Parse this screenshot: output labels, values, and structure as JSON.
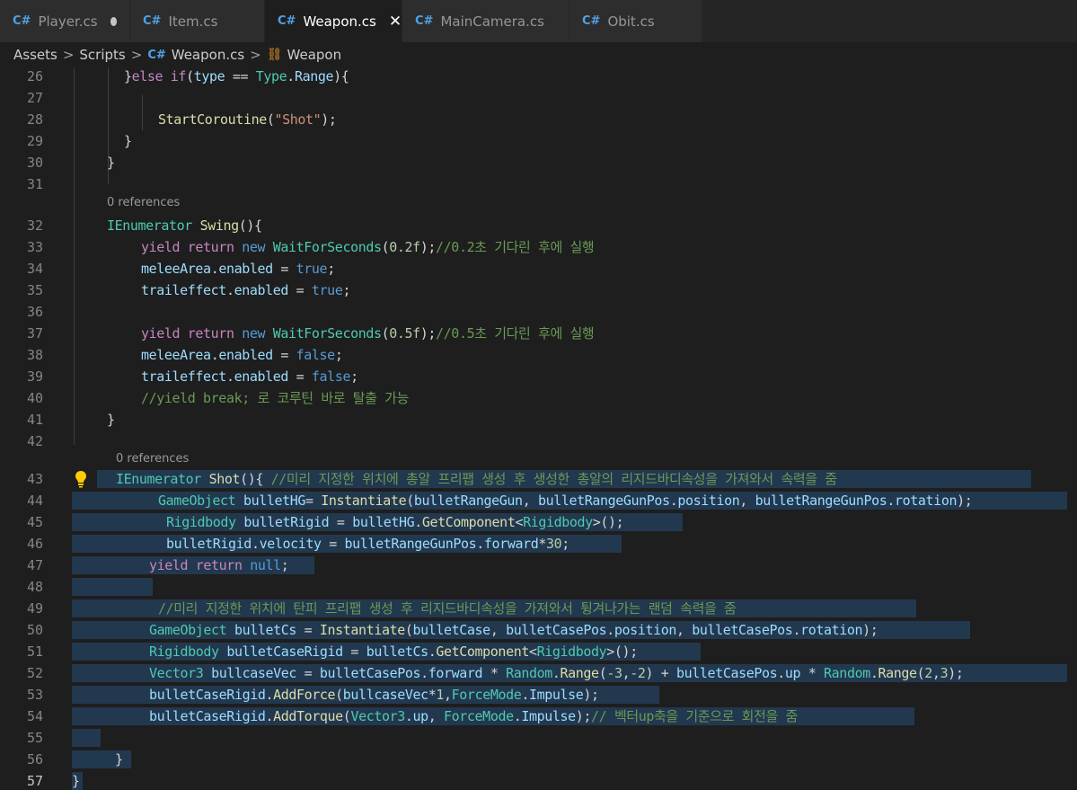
{
  "tabs": [
    {
      "label": "Player.cs",
      "modified": true,
      "active": false
    },
    {
      "label": "Item.cs",
      "modified": false,
      "active": false
    },
    {
      "label": "Weapon.cs",
      "modified": false,
      "active": true
    },
    {
      "label": "MainCamera.cs",
      "modified": false,
      "active": false
    },
    {
      "label": "Obit.cs",
      "modified": false,
      "active": false
    }
  ],
  "breadcrumb": {
    "assets": "Assets",
    "scripts": "Scripts",
    "file": "Weapon.cs",
    "class": "Weapon"
  },
  "editor": {
    "line_numbers": [
      "26",
      "27",
      "28",
      "29",
      "30",
      "31",
      "32",
      "33",
      "34",
      "35",
      "36",
      "37",
      "38",
      "39",
      "40",
      "41",
      "42",
      "43",
      "44",
      "45",
      "46",
      "47",
      "48",
      "49",
      "50",
      "51",
      "52",
      "53",
      "54",
      "55",
      "56",
      "57"
    ],
    "codelens_swing": "0 references",
    "codelens_shot": "0 references",
    "lines": {
      "l26": [
        "}",
        "else if",
        "(",
        "type",
        " == ",
        "Type",
        ".",
        "Range",
        "){"
      ],
      "l28": [
        "StartCoroutine",
        "(",
        "\"Shot\"",
        ");"
      ],
      "l29": "}",
      "l30": "}",
      "l32": [
        "IEnumerator",
        " ",
        "Swing",
        "(){"
      ],
      "l33": [
        "yield return",
        " ",
        "new",
        " ",
        "WaitForSeconds",
        "(",
        "0.2f",
        ");",
        "//0.2초 기다린 후에 실행"
      ],
      "l34": [
        "meleeArea",
        ".",
        "enabled",
        " = ",
        "true",
        ";"
      ],
      "l35": [
        "traileffect",
        ".",
        "enabled",
        " = ",
        "true",
        ";"
      ],
      "l37": [
        "yield return",
        " ",
        "new",
        " ",
        "WaitForSeconds",
        "(",
        "0.5f",
        ");",
        "//0.5초 기다린 후에 실행"
      ],
      "l38": [
        "meleeArea",
        ".",
        "enabled",
        " = ",
        "false",
        ";"
      ],
      "l39": [
        "traileffect",
        ".",
        "enabled",
        " = ",
        "false",
        ";"
      ],
      "l40": "//yield break; 로 코루틴 바로 탈출 가능",
      "l41": "}",
      "l43": [
        "IEnumerator",
        " ",
        "Shot",
        "(){ ",
        "//미리 지정한 위치에 총알 프리팹 생성 후 생성한 총알의 리지드바디속성을 가져와서 속력을 줌"
      ],
      "l44": [
        "GameObject",
        " ",
        "bulletHG",
        "= ",
        "Instantiate",
        "(",
        "bulletRangeGun",
        ", ",
        "bulletRangeGunPos",
        ".",
        "position",
        ", ",
        "bulletRangeGunPos",
        ".",
        "rotation",
        ");"
      ],
      "l45": [
        "Rigidbody",
        " ",
        "bulletRigid",
        " = ",
        "bulletHG",
        ".",
        "GetComponent",
        "<",
        "Rigidbody",
        ">();"
      ],
      "l46": [
        "bulletRigid",
        ".",
        "velocity",
        " = ",
        "bulletRangeGunPos",
        ".",
        "forward",
        "*",
        "30",
        ";"
      ],
      "l47": [
        "yield return",
        " ",
        "null",
        ";"
      ],
      "l49": "//미리 지정한 위치에 탄피 프리팹 생성 후 리지드바디속성을 가져와서 튕겨나가는 랜덤 속력을 줌",
      "l50": [
        "GameObject",
        " ",
        "bulletCs",
        " = ",
        "Instantiate",
        "(",
        "bulletCase",
        ", ",
        "bulletCasePos",
        ".",
        "position",
        ", ",
        "bulletCasePos",
        ".",
        "rotation",
        ");"
      ],
      "l51": [
        "Rigidbody",
        " ",
        "bulletCaseRigid",
        " = ",
        "bulletCs",
        ".",
        "GetComponent",
        "<",
        "Rigidbody",
        ">();"
      ],
      "l52": [
        "Vector3",
        " ",
        "bullcaseVec",
        " = ",
        "bulletCasePos",
        ".",
        "forward",
        " * ",
        "Random",
        ".",
        "Range",
        "(",
        "-3",
        ",",
        "-2",
        ") + ",
        "bulletCasePos",
        ".",
        "up",
        " * ",
        "Random",
        ".",
        "Range",
        "(",
        "2",
        ",",
        "3",
        ");"
      ],
      "l53": [
        "bulletCaseRigid",
        ".",
        "AddForce",
        "(",
        "bullcaseVec",
        "*",
        "1",
        ",",
        "ForceMode",
        ".",
        "Impulse",
        ");"
      ],
      "l54": [
        "bulletCaseRigid",
        ".",
        "AddTorque",
        "(",
        "Vector3",
        ".",
        "up",
        ", ",
        "ForceMode",
        ".",
        "Impulse",
        ");",
        "// 벡터up축을 기준으로 회전을 줌"
      ],
      "l56": "}",
      "l57": "}"
    }
  },
  "colors": {
    "background": "#1e1e1e",
    "keyword": "#569cd6",
    "control": "#c586c0",
    "type": "#4ec9b0",
    "variable": "#9cdcfe",
    "function": "#dcdcaa",
    "number": "#b5cea8",
    "string": "#ce9178",
    "comment": "#6a9955",
    "selection": "#264f78"
  },
  "icons": {
    "tab_file": "csharp-icon",
    "breadcrumb_class": "class-icon",
    "lightbulb": "lightbulb-icon"
  }
}
